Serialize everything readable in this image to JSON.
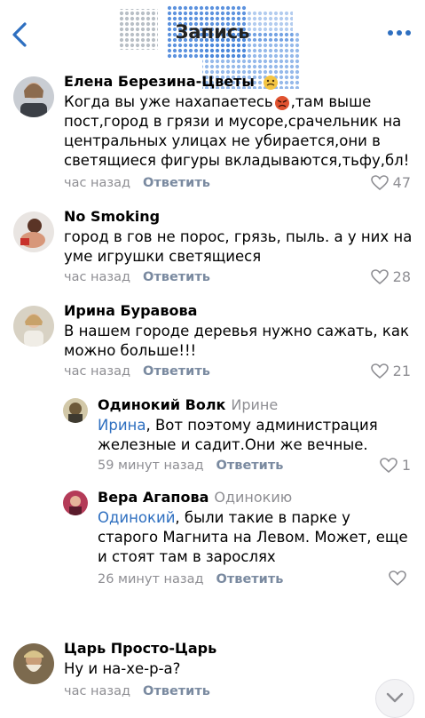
{
  "header": {
    "title": "Запись",
    "back_icon": "chevron-left-icon",
    "more_icon": "more-horizontal-icon",
    "accent": "#2e6fc0"
  },
  "comments": [
    {
      "name": "Елена Березина-Цветы",
      "name_emoji": "nauseated-face-emoji",
      "text_before": "Когда вы уже нахапаетесь",
      "text_emoji": "angry-face-emoji",
      "text_after": ",там выше пост,город в грязи и мусоре,срачельник на центральных улицах не убирается,они в светящиеся фигуры вкладываются,тьфу,бл!",
      "time": "час назад",
      "reply": "Ответить",
      "likes": "47"
    },
    {
      "name": "No Smoking",
      "text": "город в гов не порос, грязь, пыль. а у них на уме игрушки светящиеся",
      "time": "час назад",
      "reply": "Ответить",
      "likes": "28"
    },
    {
      "name": "Ирина Буравова",
      "text": "В нашем городе деревья нужно сажать, как можно больше!!!",
      "time": "час назад",
      "reply": "Ответить",
      "likes": "21"
    },
    {
      "name": "Одинокий Волк",
      "reply_to": "Ирине",
      "mention": "Ирина",
      "text": ", Вот поэтому администрация железные и садит.Они же вечные.",
      "time": "59 минут назад",
      "reply": "Ответить",
      "likes": "1"
    },
    {
      "name": "Вера Агапова",
      "reply_to": "Одинокию",
      "mention": "Одинокий",
      "text": ", были такие в парке у старого Магнита на Левом. Может, еще и стоят там в зарослях",
      "time": "26 минут назад",
      "reply": "Ответить",
      "likes": ""
    },
    {
      "name": "Царь Просто-Царь",
      "text": "Ну и на-хе-р-а?",
      "time": "час назад",
      "reply": "Ответить",
      "likes": ""
    }
  ],
  "icons": {
    "like": "heart-outline-icon",
    "scroll_down": "chevron-down-icon"
  }
}
